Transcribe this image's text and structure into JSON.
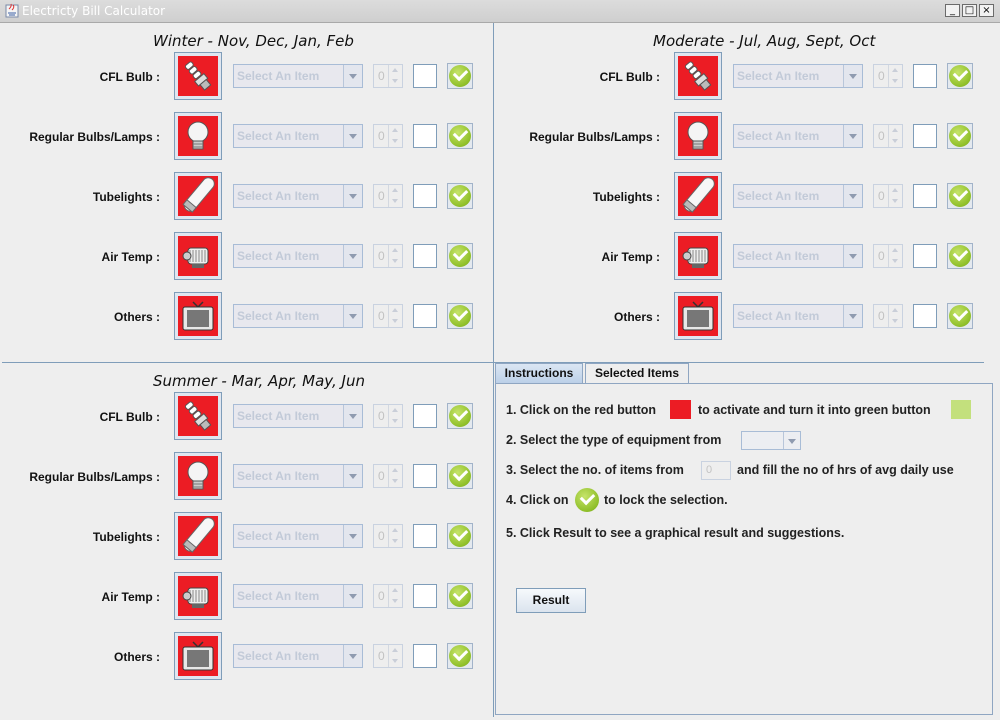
{
  "window": {
    "title": "Electricty Bill Calculator"
  },
  "panels": [
    {
      "title": "Winter - Nov, Dec, Jan, Feb"
    },
    {
      "title": "Moderate - Jul, Aug, Sept, Oct"
    },
    {
      "title": "Summer - Mar, Apr, May, Jun"
    }
  ],
  "rows": [
    {
      "label": "CFL Bulb :",
      "icon": "cfl-bulb-icon"
    },
    {
      "label": "Regular Bulbs/Lamps :",
      "icon": "light-bulb-icon"
    },
    {
      "label": "Tubelights :",
      "icon": "tubelight-icon"
    },
    {
      "label": "Air Temp :",
      "icon": "motor-icon"
    },
    {
      "label": "Others :",
      "icon": "tv-icon"
    }
  ],
  "row_controls": {
    "combo_placeholder": "Select An Item",
    "spinner_value": "0"
  },
  "tabs": [
    {
      "label": "Instructions",
      "selected": true
    },
    {
      "label": "Selected Items",
      "selected": false
    }
  ],
  "instructions": {
    "s1a": "1. Click on the red button",
    "s1b": "to activate and turn it into green button",
    "s2": "2. Select the type of equipment from",
    "s3a": "3. Select the no. of items from",
    "s3b": "and fill the no of hrs of avg daily use",
    "spin_val": "0",
    "s4a": "4. Click on",
    "s4b": "to lock the selection.",
    "s5": "5. Click Result to see a graphical result and suggestions."
  },
  "result_button": "Result",
  "colors": {
    "toggle_red": "#ec1c24",
    "toggle_green": "#c3e07d",
    "check_green": "#8fbf2a"
  }
}
